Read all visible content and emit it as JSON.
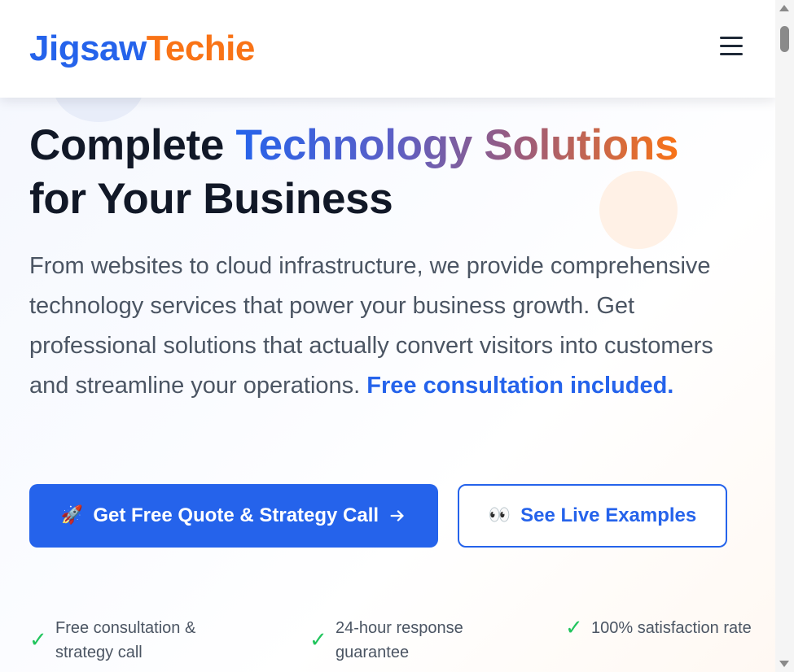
{
  "brand": {
    "part1": "Jigsaw",
    "part2": "Techie",
    "primary_color": "#2563eb",
    "accent_color": "#f97316"
  },
  "header": {
    "menu_icon": "hamburger-menu-icon"
  },
  "hero": {
    "title_start": "Complete ",
    "title_gradient": "Technology Solutions",
    "title_end": "for Your Business",
    "description": "From websites to cloud infrastructure, we provide comprehensive technology services that power your business growth. Get professional solutions that actually convert visitors into customers and streamline your operations. ",
    "description_highlight": "Free consultation included."
  },
  "cta": {
    "primary_emoji": "🚀",
    "primary_label": "Get Free Quote & Strategy Call",
    "primary_icon": "arrow-right-icon",
    "secondary_emoji": "👀",
    "secondary_label": "See Live Examples"
  },
  "features": [
    {
      "check": "✓",
      "text": "Free consultation & strategy call"
    },
    {
      "check": "✓",
      "text": "24-hour response guarantee"
    },
    {
      "check": "✓",
      "text": "100% satisfaction rate"
    }
  ],
  "colors": {
    "check": "#22c55e",
    "heading": "#111827",
    "body_text": "#4b5563"
  }
}
